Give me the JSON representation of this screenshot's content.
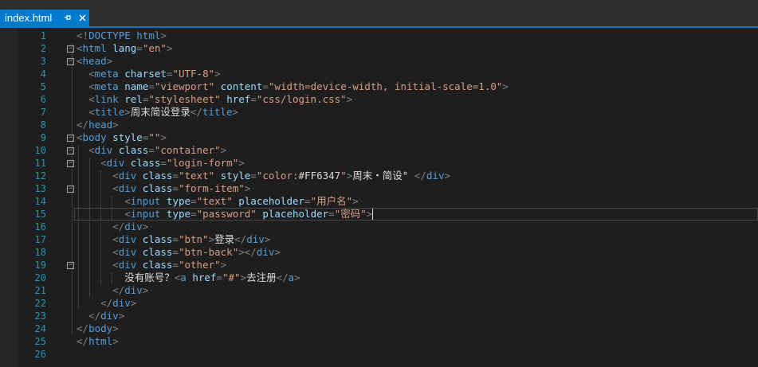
{
  "tab": {
    "title": "index.html",
    "pin_icon": "pin-icon",
    "close_icon": "close-icon"
  },
  "colors": {
    "accent": "#007acc",
    "background": "#1e1e1e",
    "line_number": "#2b91af",
    "tag": "#569cd6",
    "attribute": "#9cdcfe",
    "string": "#d69d85",
    "bracket": "#808080"
  },
  "editor": {
    "current_line": 15,
    "lines": [
      {
        "n": "1",
        "fold": "",
        "segs": [
          [
            "br",
            "<!"
          ],
          [
            "tag",
            "DOCTYPE html"
          ],
          [
            "br",
            ">"
          ]
        ]
      },
      {
        "n": "2",
        "fold": "−",
        "segs": [
          [
            "br",
            "<"
          ],
          [
            "tag",
            "html"
          ],
          [
            "txt",
            " "
          ],
          [
            "attr",
            "lang"
          ],
          [
            "br",
            "="
          ],
          [
            "str",
            "\"en\""
          ],
          [
            "br",
            ">"
          ]
        ]
      },
      {
        "n": "3",
        "fold": "−",
        "segs": [
          [
            "br",
            "<"
          ],
          [
            "tag",
            "head"
          ],
          [
            "br",
            ">"
          ]
        ]
      },
      {
        "n": "4",
        "fold": "",
        "segs": [
          [
            "txt",
            "  "
          ],
          [
            "br",
            "<"
          ],
          [
            "tag",
            "meta"
          ],
          [
            "txt",
            " "
          ],
          [
            "attr",
            "charset"
          ],
          [
            "br",
            "="
          ],
          [
            "str",
            "\"UTF-8\""
          ],
          [
            "br",
            ">"
          ]
        ]
      },
      {
        "n": "5",
        "fold": "",
        "segs": [
          [
            "txt",
            "  "
          ],
          [
            "br",
            "<"
          ],
          [
            "tag",
            "meta"
          ],
          [
            "txt",
            " "
          ],
          [
            "attr",
            "name"
          ],
          [
            "br",
            "="
          ],
          [
            "str",
            "\"viewport\""
          ],
          [
            "txt",
            " "
          ],
          [
            "attr",
            "content"
          ],
          [
            "br",
            "="
          ],
          [
            "str",
            "\"width=device-width, initial-scale=1.0\""
          ],
          [
            "br",
            ">"
          ]
        ]
      },
      {
        "n": "6",
        "fold": "",
        "segs": [
          [
            "txt",
            "  "
          ],
          [
            "br",
            "<"
          ],
          [
            "tag",
            "link"
          ],
          [
            "txt",
            " "
          ],
          [
            "attr",
            "rel"
          ],
          [
            "br",
            "="
          ],
          [
            "str",
            "\"stylesheet\""
          ],
          [
            "txt",
            " "
          ],
          [
            "attr",
            "href"
          ],
          [
            "br",
            "="
          ],
          [
            "str",
            "\"css/login.css\""
          ],
          [
            "br",
            ">"
          ]
        ]
      },
      {
        "n": "7",
        "fold": "",
        "segs": [
          [
            "txt",
            "  "
          ],
          [
            "br",
            "<"
          ],
          [
            "tag",
            "title"
          ],
          [
            "br",
            ">"
          ],
          [
            "txt",
            "周末简设登录"
          ],
          [
            "br",
            "</"
          ],
          [
            "tag",
            "title"
          ],
          [
            "br",
            ">"
          ]
        ]
      },
      {
        "n": "8",
        "fold": "",
        "segs": [
          [
            "br",
            "</"
          ],
          [
            "tag",
            "head"
          ],
          [
            "br",
            ">"
          ]
        ]
      },
      {
        "n": "9",
        "fold": "−",
        "segs": [
          [
            "br",
            "<"
          ],
          [
            "tag",
            "body"
          ],
          [
            "txt",
            " "
          ],
          [
            "attr",
            "style"
          ],
          [
            "br",
            "="
          ],
          [
            "str",
            "\"\""
          ],
          [
            "br",
            ">"
          ]
        ]
      },
      {
        "n": "10",
        "fold": "−",
        "segs": [
          [
            "txt",
            "  "
          ],
          [
            "br",
            "<"
          ],
          [
            "tag",
            "div"
          ],
          [
            "txt",
            " "
          ],
          [
            "attr",
            "class"
          ],
          [
            "br",
            "="
          ],
          [
            "str",
            "\"container\""
          ],
          [
            "br",
            ">"
          ]
        ]
      },
      {
        "n": "11",
        "fold": "−",
        "segs": [
          [
            "txt",
            "    "
          ],
          [
            "br",
            "<"
          ],
          [
            "tag",
            "div"
          ],
          [
            "txt",
            " "
          ],
          [
            "attr",
            "class"
          ],
          [
            "br",
            "="
          ],
          [
            "str",
            "\"login-form\""
          ],
          [
            "br",
            ">"
          ]
        ]
      },
      {
        "n": "12",
        "fold": "",
        "segs": [
          [
            "txt",
            "      "
          ],
          [
            "br",
            "<"
          ],
          [
            "tag",
            "div"
          ],
          [
            "txt",
            " "
          ],
          [
            "attr",
            "class"
          ],
          [
            "br",
            "="
          ],
          [
            "str",
            "\"text\""
          ],
          [
            "txt",
            " "
          ],
          [
            "attr",
            "style"
          ],
          [
            "br",
            "="
          ],
          [
            "str",
            "\"color:"
          ],
          [
            "txt",
            "#FF6347"
          ],
          [
            "str",
            "\""
          ],
          [
            "br",
            ">"
          ],
          [
            "txt",
            "周末・简设° "
          ],
          [
            "br",
            "</"
          ],
          [
            "tag",
            "div"
          ],
          [
            "br",
            ">"
          ]
        ]
      },
      {
        "n": "13",
        "fold": "−",
        "segs": [
          [
            "txt",
            "      "
          ],
          [
            "br",
            "<"
          ],
          [
            "tag",
            "div"
          ],
          [
            "txt",
            " "
          ],
          [
            "attr",
            "class"
          ],
          [
            "br",
            "="
          ],
          [
            "str",
            "\"form-item\""
          ],
          [
            "br",
            ">"
          ]
        ]
      },
      {
        "n": "14",
        "fold": "",
        "segs": [
          [
            "txt",
            "        "
          ],
          [
            "br",
            "<"
          ],
          [
            "tag",
            "input"
          ],
          [
            "txt",
            " "
          ],
          [
            "attr",
            "type"
          ],
          [
            "br",
            "="
          ],
          [
            "str",
            "\"text\""
          ],
          [
            "txt",
            " "
          ],
          [
            "attr",
            "placeholder"
          ],
          [
            "br",
            "="
          ],
          [
            "str",
            "\"用户名\""
          ],
          [
            "br",
            ">"
          ]
        ]
      },
      {
        "n": "15",
        "fold": "",
        "segs": [
          [
            "txt",
            "        "
          ],
          [
            "br",
            "<"
          ],
          [
            "tag",
            "input"
          ],
          [
            "txt",
            " "
          ],
          [
            "attr",
            "type"
          ],
          [
            "br",
            "="
          ],
          [
            "str",
            "\"password\""
          ],
          [
            "txt",
            " "
          ],
          [
            "attr",
            "placeholder"
          ],
          [
            "br",
            "="
          ],
          [
            "str",
            "\"密码\""
          ],
          [
            "br",
            ">"
          ]
        ]
      },
      {
        "n": "16",
        "fold": "",
        "segs": [
          [
            "txt",
            "      "
          ],
          [
            "br",
            "</"
          ],
          [
            "tag",
            "div"
          ],
          [
            "br",
            ">"
          ]
        ]
      },
      {
        "n": "17",
        "fold": "",
        "segs": [
          [
            "txt",
            "      "
          ],
          [
            "br",
            "<"
          ],
          [
            "tag",
            "div"
          ],
          [
            "txt",
            " "
          ],
          [
            "attr",
            "class"
          ],
          [
            "br",
            "="
          ],
          [
            "str",
            "\"btn\""
          ],
          [
            "br",
            ">"
          ],
          [
            "txt",
            "登录"
          ],
          [
            "br",
            "</"
          ],
          [
            "tag",
            "div"
          ],
          [
            "br",
            ">"
          ]
        ]
      },
      {
        "n": "18",
        "fold": "",
        "segs": [
          [
            "txt",
            "      "
          ],
          [
            "br",
            "<"
          ],
          [
            "tag",
            "div"
          ],
          [
            "txt",
            " "
          ],
          [
            "attr",
            "class"
          ],
          [
            "br",
            "="
          ],
          [
            "str",
            "\"btn-back\""
          ],
          [
            "br",
            ">"
          ],
          [
            "br",
            "</"
          ],
          [
            "tag",
            "div"
          ],
          [
            "br",
            ">"
          ]
        ]
      },
      {
        "n": "19",
        "fold": "−",
        "segs": [
          [
            "txt",
            "      "
          ],
          [
            "br",
            "<"
          ],
          [
            "tag",
            "div"
          ],
          [
            "txt",
            " "
          ],
          [
            "attr",
            "class"
          ],
          [
            "br",
            "="
          ],
          [
            "str",
            "\"other\""
          ],
          [
            "br",
            ">"
          ]
        ]
      },
      {
        "n": "20",
        "fold": "",
        "segs": [
          [
            "txt",
            "        没有账号？"
          ],
          [
            "br",
            "<"
          ],
          [
            "tag",
            "a"
          ],
          [
            "txt",
            " "
          ],
          [
            "attr",
            "href"
          ],
          [
            "br",
            "="
          ],
          [
            "str",
            "\"#\""
          ],
          [
            "br",
            ">"
          ],
          [
            "txt",
            "去注册"
          ],
          [
            "br",
            "</"
          ],
          [
            "tag",
            "a"
          ],
          [
            "br",
            ">"
          ]
        ]
      },
      {
        "n": "21",
        "fold": "",
        "segs": [
          [
            "txt",
            "      "
          ],
          [
            "br",
            "</"
          ],
          [
            "tag",
            "div"
          ],
          [
            "br",
            ">"
          ]
        ]
      },
      {
        "n": "22",
        "fold": "",
        "segs": [
          [
            "txt",
            "    "
          ],
          [
            "br",
            "</"
          ],
          [
            "tag",
            "div"
          ],
          [
            "br",
            ">"
          ]
        ]
      },
      {
        "n": "23",
        "fold": "",
        "segs": [
          [
            "txt",
            "  "
          ],
          [
            "br",
            "</"
          ],
          [
            "tag",
            "div"
          ],
          [
            "br",
            ">"
          ]
        ]
      },
      {
        "n": "24",
        "fold": "",
        "segs": [
          [
            "br",
            "</"
          ],
          [
            "tag",
            "body"
          ],
          [
            "br",
            ">"
          ]
        ]
      },
      {
        "n": "25",
        "fold": "",
        "segs": [
          [
            "br",
            "</"
          ],
          [
            "tag",
            "html"
          ],
          [
            "br",
            ">"
          ]
        ]
      },
      {
        "n": "26",
        "fold": "",
        "segs": []
      }
    ]
  }
}
